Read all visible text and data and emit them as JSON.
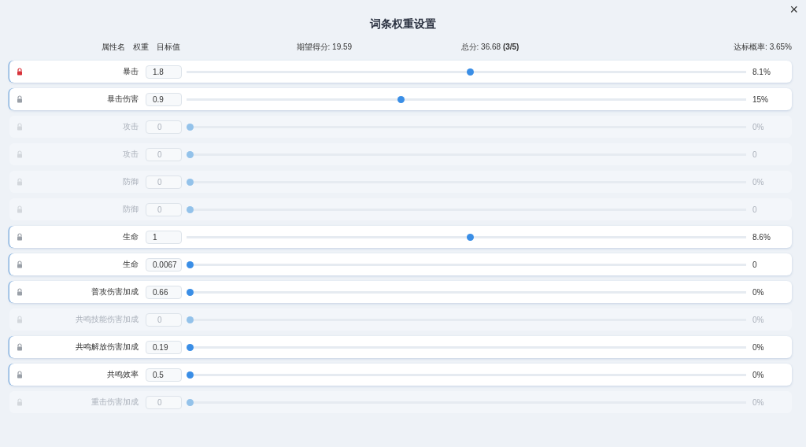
{
  "dialog": {
    "title": "词条权重设置",
    "close": "×"
  },
  "header": {
    "columns": [
      "属性名",
      "权重",
      "目标值"
    ],
    "expected": "期望得分: 19.59",
    "total": "总分: 36.68 **(3/5)**",
    "probability": "达标概率: 3.65%"
  },
  "rows": [
    {
      "name": "暴击",
      "weight": "1.8",
      "level": 0.5,
      "reading": "8.1%",
      "active": true,
      "locked": true
    },
    {
      "name": "暴击伤害",
      "weight": "0.9",
      "level": 0.377,
      "reading": "15%",
      "active": true,
      "locked": false
    },
    {
      "name": "攻击",
      "weight": "0",
      "level": 0,
      "reading": "0%",
      "active": false,
      "locked": false
    },
    {
      "name": "攻击",
      "weight": "0",
      "level": 0,
      "reading": "0",
      "active": false,
      "locked": false
    },
    {
      "name": "防御",
      "weight": "0",
      "level": 0,
      "reading": "0%",
      "active": false,
      "locked": false
    },
    {
      "name": "防御",
      "weight": "0",
      "level": 0,
      "reading": "0",
      "active": false,
      "locked": false
    },
    {
      "name": "生命",
      "weight": "1",
      "level": 0.5,
      "reading": "8.6%",
      "active": true,
      "locked": false
    },
    {
      "name": "生命",
      "weight": "0.0067",
      "level": 0,
      "reading": "0",
      "active": true,
      "locked": false
    },
    {
      "name": "普攻伤害加成",
      "weight": "0.66",
      "level": 0,
      "reading": "0%",
      "active": true,
      "locked": false
    },
    {
      "name": "共鸣技能伤害加成",
      "weight": "0",
      "level": 0,
      "reading": "0%",
      "active": false,
      "locked": false
    },
    {
      "name": "共鸣解放伤害加成",
      "weight": "0.19",
      "level": 0,
      "reading": "0%",
      "active": true,
      "locked": false
    },
    {
      "name": "共鸣效率",
      "weight": "0.5",
      "level": 0,
      "reading": "0%",
      "active": true,
      "locked": false
    },
    {
      "name": "重击伤害加成",
      "weight": "0",
      "level": 0,
      "reading": "0%",
      "active": false,
      "locked": false
    }
  ]
}
